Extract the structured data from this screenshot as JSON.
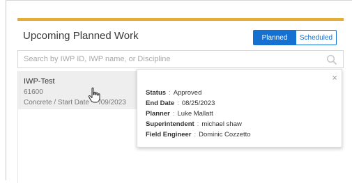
{
  "panel": {
    "title": "Upcoming Planned Work",
    "toggle": {
      "planned": "Planned",
      "scheduled": "Scheduled"
    },
    "search_placeholder": "Search by IWP ID, IWP name, or Discipline"
  },
  "work_item": {
    "name": "IWP-Test",
    "id": "61600",
    "discipline": "Concrete / Start Date",
    "date_visible": "/09/2023"
  },
  "popover": {
    "rows": [
      {
        "label": "Status",
        "value": "Approved"
      },
      {
        "label": "End Date",
        "value": "08/25/2023"
      },
      {
        "label": "Planner",
        "value": "Luke Mallatt"
      },
      {
        "label": "Superintendent",
        "value": "michael shaw"
      },
      {
        "label": "Field Engineer",
        "value": "Dominic Cozzetto"
      }
    ],
    "separator": ":",
    "close_glyph": "×"
  },
  "colors": {
    "accent_bar": "#e7ac34",
    "primary": "#1470d1"
  },
  "icons": [
    "search-icon",
    "close-icon",
    "hand-cursor-icon"
  ]
}
